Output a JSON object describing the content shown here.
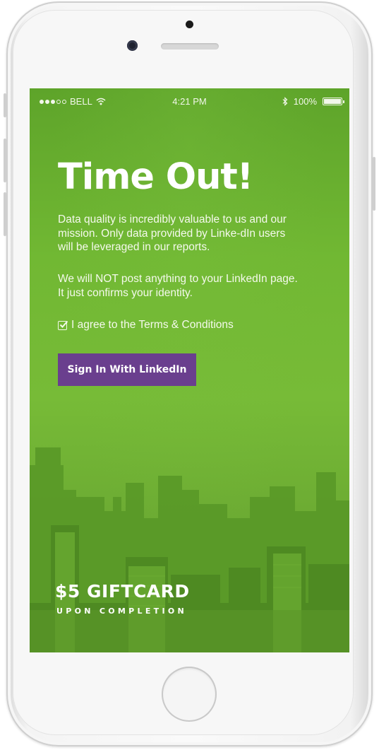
{
  "status_bar": {
    "carrier": "BELL",
    "time": "4:21 PM",
    "battery_percent": "100%",
    "battery_level": 1.0,
    "signal_dots_filled": 3,
    "signal_dots_total": 5
  },
  "main": {
    "title": "Time Out!",
    "paragraph1": "Data quality is incredibly valuable to us and our mission. Only data provided by Linke-dIn users will be leveraged in our reports.",
    "paragraph2": "We will NOT post anything to your LinkedIn page. It just confirms your identity.",
    "agree_label": "I agree to the Terms & Conditions",
    "agree_checked": true,
    "signin_label": "Sign In With LinkedIn"
  },
  "promo": {
    "headline": "$5 GIFTCARD",
    "subline": "UPON COMPLETION"
  },
  "colors": {
    "screen_green": "#72b634",
    "button_purple": "#6a3f8e",
    "text_white": "#ffffff"
  },
  "icons": [
    "wifi-icon",
    "bluetooth-icon",
    "battery-icon",
    "checkbox-icon"
  ]
}
